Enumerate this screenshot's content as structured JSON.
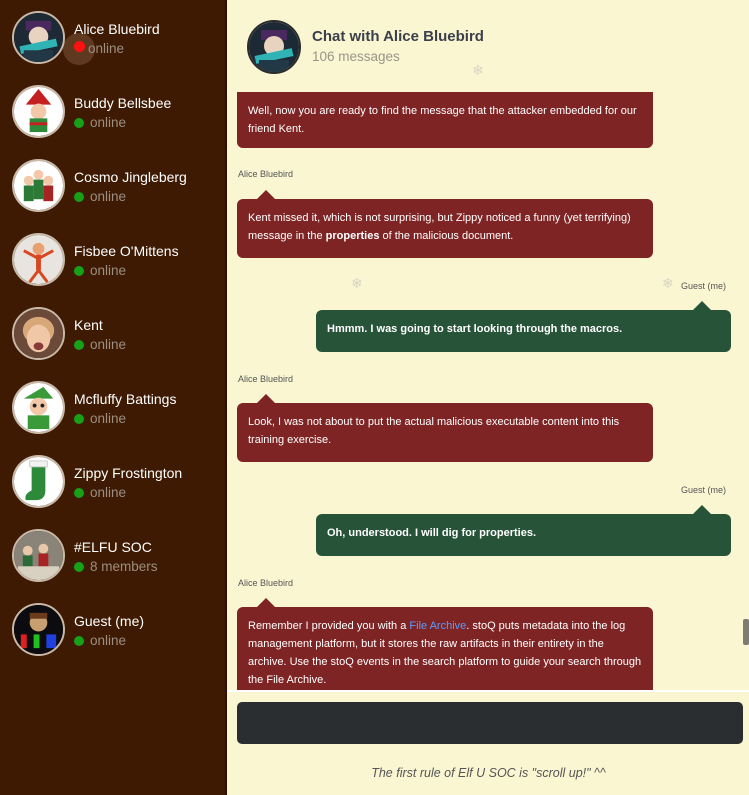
{
  "sidebar": {
    "contacts": [
      {
        "name": "Alice Bluebird",
        "status": "online"
      },
      {
        "name": "Buddy Bellsbee",
        "status": "online"
      },
      {
        "name": "Cosmo Jingleberg",
        "status": "online"
      },
      {
        "name": "Fisbee O'Mittens",
        "status": "online"
      },
      {
        "name": "Kent",
        "status": "online"
      },
      {
        "name": "Mcfluffy Battings",
        "status": "online"
      },
      {
        "name": "Zippy Frostington",
        "status": "online"
      },
      {
        "name": "#ELFU SOC",
        "status": "8 members"
      },
      {
        "name": "Guest (me)",
        "status": "online"
      }
    ]
  },
  "header": {
    "title": "Chat with Alice Bluebird",
    "message_count": "106 messages"
  },
  "messages": [
    {
      "sender": "",
      "text": "Well, now you are ready to find the message that the attacker embedded for our friend Kent."
    },
    {
      "sender": "Alice Bluebird",
      "text_before": "Kent missed it, which is not surprising, but Zippy noticed a funny (yet terrifying) message in the ",
      "bold": "properties",
      "text_after": " of the malicious document."
    },
    {
      "sender": "Guest (me)",
      "text": "Hmmm. I was going to start looking through the macros."
    },
    {
      "sender": "Alice Bluebird",
      "text": "Look, I was not about to put the actual malicious executable content into this training exercise."
    },
    {
      "sender": "Guest (me)",
      "text": "Oh, understood. I will dig for properties."
    },
    {
      "sender": "Alice Bluebird",
      "text_before": "Remember I provided you with a ",
      "link": "File Archive",
      "text_after": ". stoQ puts metadata into the log management platform, but it stores the raw artifacts in their entirety in the archive. Use the stoQ events in the search platform to guide your search through the File Archive."
    }
  ],
  "input": {
    "value": ""
  },
  "footer": {
    "note": "The first rule of Elf U SOC is \"scroll up!\" ^^"
  },
  "colors": {
    "sidebar_bg": "#3e1a02",
    "chat_bg": "#faf6d2",
    "elf_bubble": "#7f2424",
    "user_bubble": "#275439",
    "online": "#16a116",
    "active": "#ff1111",
    "link": "#5a9cff"
  },
  "icons": [
    "snowflake-icon"
  ]
}
